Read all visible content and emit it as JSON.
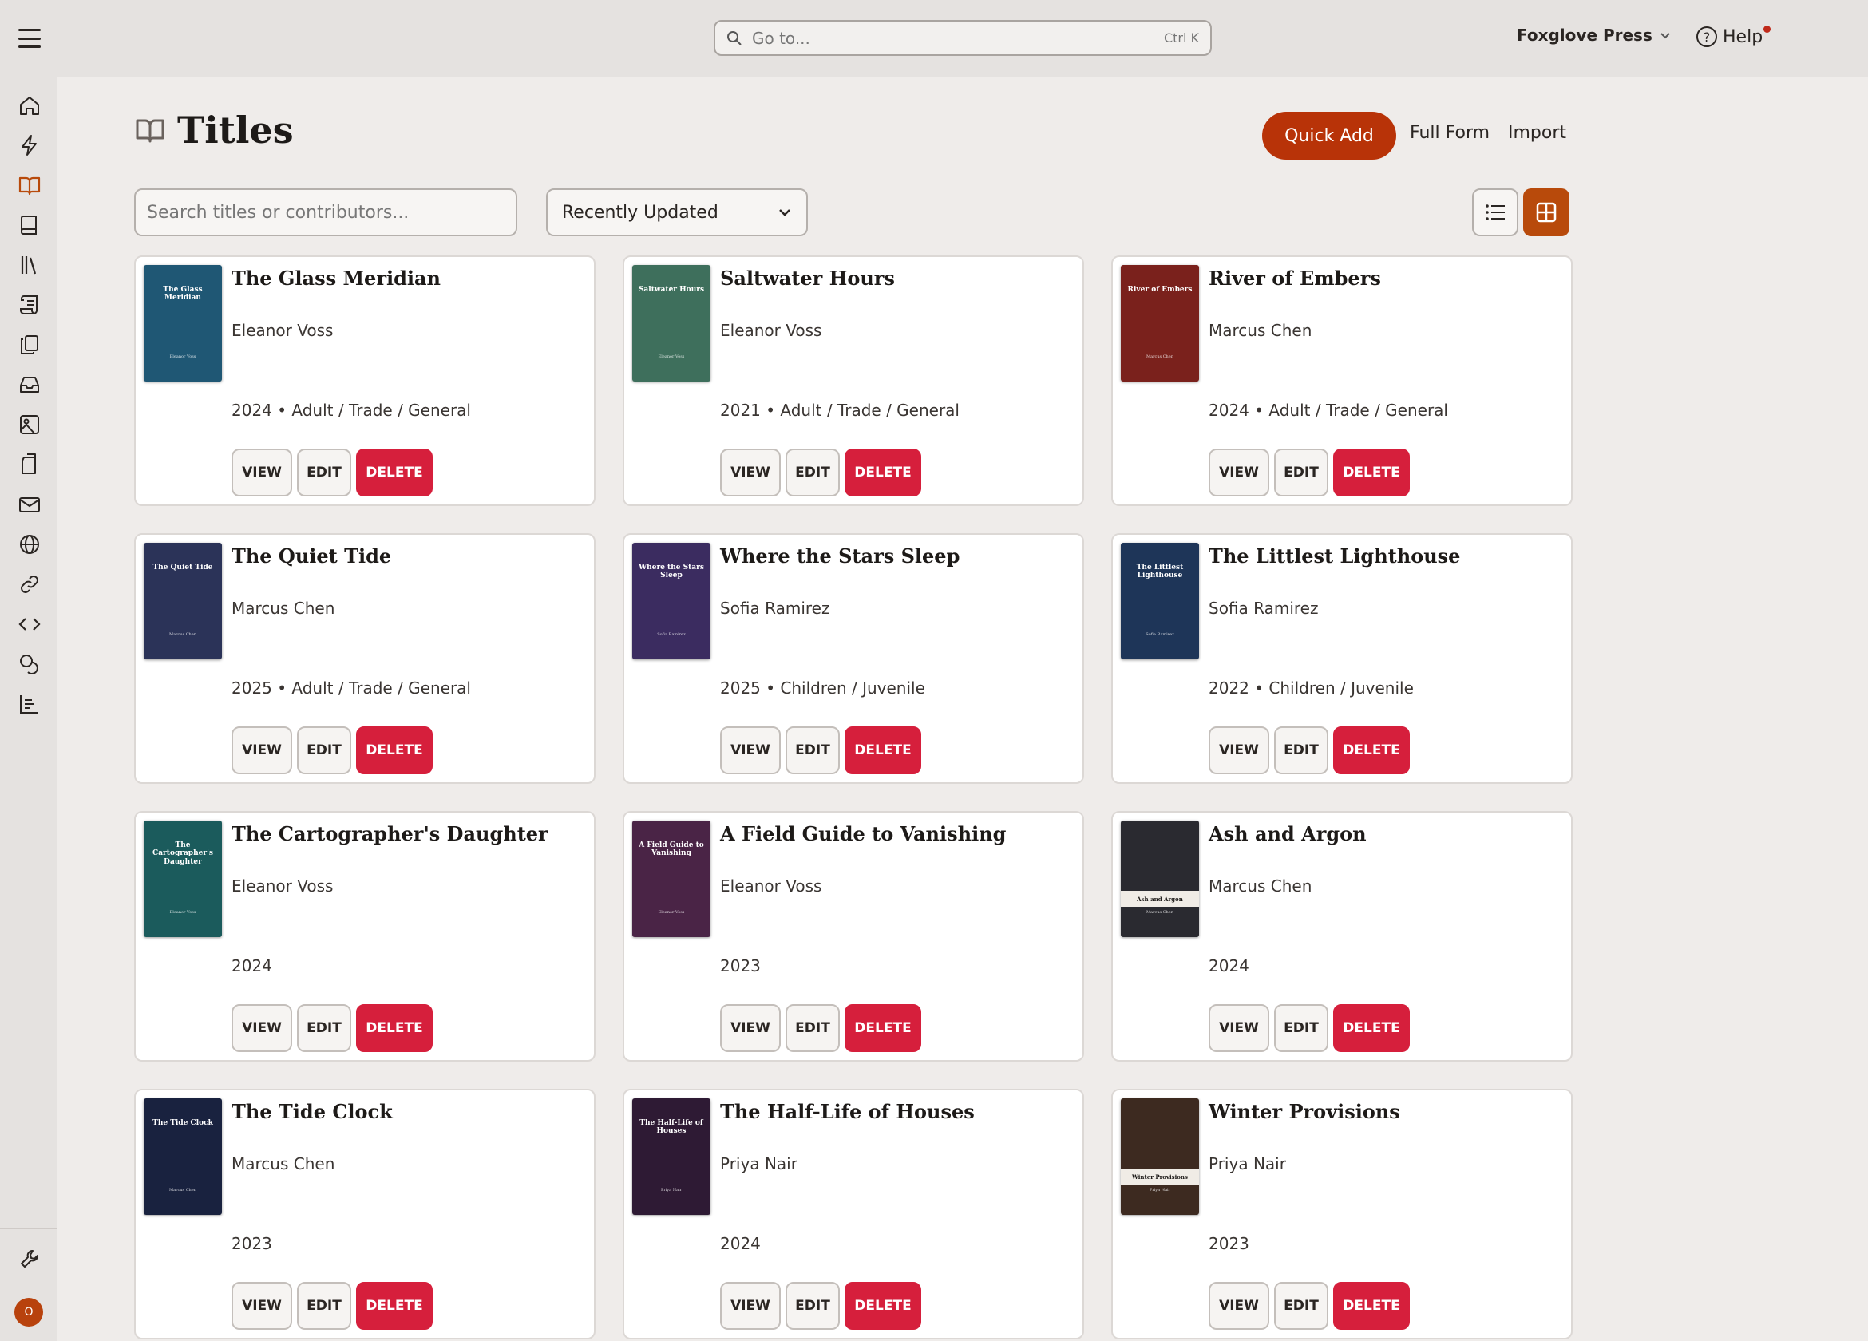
{
  "topbar": {
    "search_placeholder": "Go to...",
    "shortcut": "Ctrl K",
    "org_name": "Foxglove Press",
    "help_label": "Help"
  },
  "sidebar": {
    "icons": [
      "home-icon",
      "bolt-icon",
      "book-open-icon",
      "book-icon",
      "library-icon",
      "scroll-icon",
      "copy-icon",
      "inbox-icon",
      "image-icon",
      "export-icon",
      "mail-icon",
      "globe-icon",
      "link-icon",
      "code-icon",
      "coins-icon",
      "chart-icon"
    ],
    "settings_icon": "wrench-icon",
    "avatar_initial": "O"
  },
  "page": {
    "title": "Titles",
    "quick_add": "Quick Add",
    "full_form": "Full Form",
    "import": "Import",
    "filter_placeholder": "Search titles or contributors...",
    "sort_value": "Recently Updated",
    "accent": "#b83308",
    "danger": "#d61f3c"
  },
  "labels": {
    "view": "VIEW",
    "edit": "EDIT",
    "delete": "DELETE"
  },
  "titles": [
    {
      "title": "The Glass Meridian",
      "author": "Eleanor Voss",
      "meta": "2024 • Adult / Trade / General",
      "cover_color": "#1f5774",
      "cover_title": "The Glass Meridian"
    },
    {
      "title": "Saltwater Hours",
      "author": "Eleanor Voss",
      "meta": "2021 • Adult / Trade / General",
      "cover_color": "#3e6f5c",
      "cover_title": "Saltwater Hours"
    },
    {
      "title": "River of Embers",
      "author": "Marcus Chen",
      "meta": "2024 • Adult / Trade / General",
      "cover_color": "#7a211c",
      "cover_title": "River of Embers"
    },
    {
      "title": "The Quiet Tide",
      "author": "Marcus Chen",
      "meta": "2025 • Adult / Trade / General",
      "cover_color": "#2b3358",
      "cover_title": "The Quiet Tide"
    },
    {
      "title": "Where the Stars Sleep",
      "author": "Sofia Ramirez",
      "meta": "2025 • Children / Juvenile",
      "cover_color": "#3b2c60",
      "cover_title": "Where the Stars Sleep"
    },
    {
      "title": "The Littlest Lighthouse",
      "author": "Sofia Ramirez",
      "meta": "2022 • Children / Juvenile",
      "cover_color": "#1e3558",
      "cover_title": "The Littlest Lighthouse"
    },
    {
      "title": "The Cartographer's Daughter",
      "author": "Eleanor Voss",
      "meta": "2024",
      "cover_color": "#1b5b5c",
      "cover_title": "The Cartographer's Daughter"
    },
    {
      "title": "A Field Guide to Vanishing",
      "author": "Eleanor Voss",
      "meta": "2023",
      "cover_color": "#4a2446",
      "cover_title": "A Field Guide to Vanishing"
    },
    {
      "title": "Ash and Argon",
      "author": "Marcus Chen",
      "meta": "2024",
      "cover_color": "#2a2a30",
      "cover_title": "Ash and Argon"
    },
    {
      "title": "The Tide Clock",
      "author": "Marcus Chen",
      "meta": "2023",
      "cover_color": "#19223f",
      "cover_title": "The Tide Clock"
    },
    {
      "title": "The Half-Life of Houses",
      "author": "Priya Nair",
      "meta": "2024",
      "cover_color": "#2e1a34",
      "cover_title": "The Half-Life of Houses"
    },
    {
      "title": "Winter Provisions",
      "author": "Priya Nair",
      "meta": "2023",
      "cover_color": "#3d2a20",
      "cover_title": "Winter Provisions"
    }
  ]
}
